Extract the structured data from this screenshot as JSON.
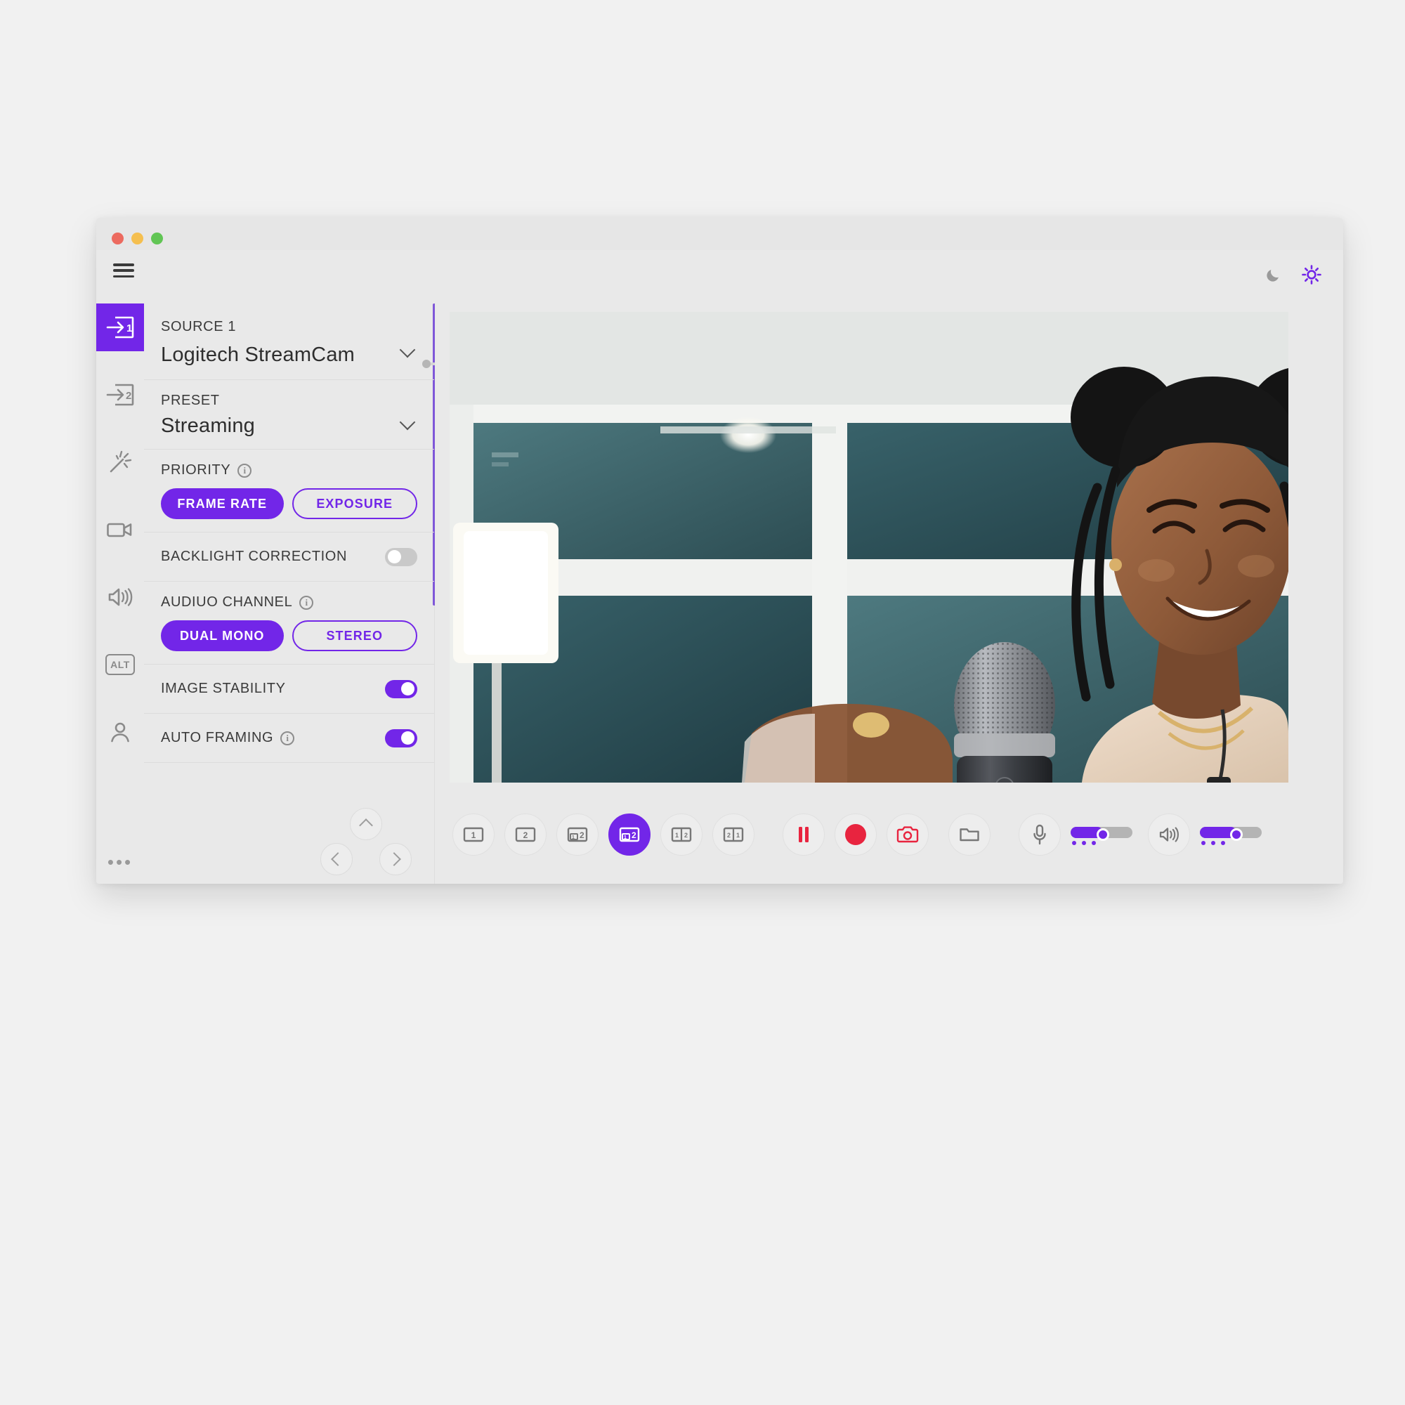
{
  "window": {
    "traffic_lights": [
      "close",
      "minimize",
      "zoom"
    ],
    "accent_color": "#7226e8",
    "record_color": "#e8243f"
  },
  "topbar": {
    "menu_icon": "hamburger-icon",
    "dark_mode_icon": "moon-icon",
    "light_mode_icon": "sun-icon"
  },
  "rail": {
    "items": [
      {
        "icon": "source-1-icon",
        "label": "Source 1",
        "active": true
      },
      {
        "icon": "source-2-icon",
        "label": "Source 2",
        "active": false
      },
      {
        "icon": "magic-wand-icon",
        "label": "Effects",
        "active": false
      },
      {
        "icon": "camcorder-icon",
        "label": "Video",
        "active": false
      },
      {
        "icon": "speaker-icon",
        "label": "Audio",
        "active": false
      },
      {
        "icon": "alt-key-icon",
        "label": "ALT",
        "active": false
      },
      {
        "icon": "user-icon",
        "label": "Account",
        "active": false
      }
    ],
    "alt_label": "ALT",
    "more_label": "•••"
  },
  "panel": {
    "source": {
      "label": "SOURCE 1",
      "value": "Logitech StreamCam"
    },
    "preset": {
      "label": "PRESET",
      "value": "Streaming"
    },
    "priority": {
      "label": "PRIORITY",
      "info": "i",
      "options": [
        {
          "text": "FRAME RATE",
          "selected": true
        },
        {
          "text": "EXPOSURE",
          "selected": false
        }
      ]
    },
    "backlight": {
      "label": "BACKLIGHT CORRECTION",
      "enabled": false
    },
    "audio_channel": {
      "label": "AUDIUO CHANNEL",
      "info": "i",
      "options": [
        {
          "text": "DUAL MONO",
          "selected": true
        },
        {
          "text": "STEREO",
          "selected": false
        }
      ]
    },
    "image_stability": {
      "label": "IMAGE STABILITY",
      "enabled": true
    },
    "auto_framing": {
      "label": "AUTO FRAMING",
      "info": "i",
      "enabled": true
    },
    "nav": {
      "up": "pan-up-button",
      "left": "pan-left-button",
      "right": "pan-right-button",
      "zoom_value": 0
    }
  },
  "controls": {
    "layouts": [
      {
        "name": "layout-single-1",
        "text": "1",
        "selected": false
      },
      {
        "name": "layout-single-2",
        "text": "2",
        "selected": false
      },
      {
        "name": "layout-pip-1-over-2",
        "text": "1 2",
        "selected": false
      },
      {
        "name": "layout-pip-1-over-2-alt",
        "text": "1 2",
        "selected": true
      },
      {
        "name": "layout-split-1-2",
        "text": "1 2",
        "selected": false
      },
      {
        "name": "layout-split-2-1",
        "text": "2 1",
        "selected": false
      }
    ],
    "pause": {
      "name": "pause-button",
      "icon": "pause-icon"
    },
    "record": {
      "name": "record-button",
      "icon": "record-icon"
    },
    "snapshot": {
      "name": "snapshot-button",
      "icon": "camera-icon"
    },
    "folder": {
      "name": "open-folder-button",
      "icon": "folder-icon"
    },
    "mic": {
      "name": "microphone-button",
      "icon": "microphone-icon",
      "level": 42
    },
    "speaker": {
      "name": "speaker-button",
      "icon": "speaker-icon",
      "level": 52
    }
  }
}
